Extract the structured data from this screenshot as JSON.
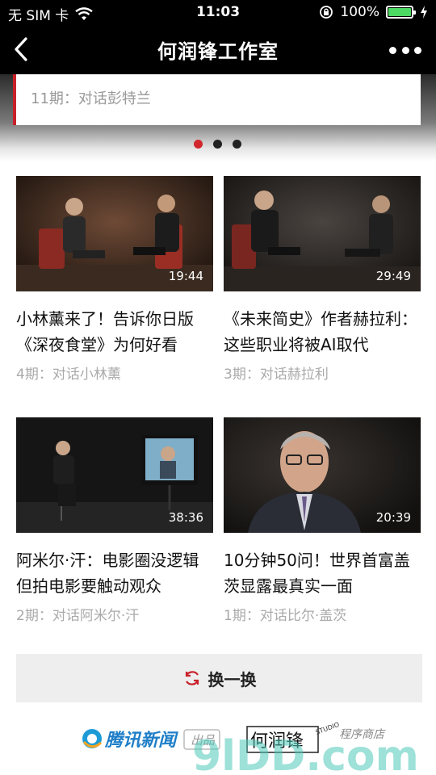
{
  "status_bar": {
    "carrier": "无 SIM 卡",
    "time": "11:03",
    "battery": "100%",
    "battery_level": 1.0
  },
  "nav": {
    "title": "何润锋工作室"
  },
  "banner": {
    "text": "11期：对话彭特兰",
    "pages": 3,
    "active_page": 1
  },
  "videos": [
    {
      "duration": "19:44",
      "title": "小林薰来了！告诉你日版《深夜食堂》为何好看",
      "episode": "4期：对话小林薰"
    },
    {
      "duration": "29:49",
      "title": "《未来简史》作者赫拉利：这些职业将被AI取代",
      "episode": "3期：对话赫拉利"
    },
    {
      "duration": "38:36",
      "title": "阿米尔·汗：电影圈没逻辑 但拍电影要触动观众",
      "episode": "2期：对话阿米尔·汗"
    },
    {
      "duration": "20:39",
      "title": "10分钟50问！世界首富盖茨显露最真实一面",
      "episode": "1期：对话比尔·盖茨"
    }
  ],
  "refresh_label": "换一换",
  "footer": {
    "brand": "腾讯新闻",
    "tag": "出品",
    "studio": "何润锋",
    "studio_en": "STUDIO",
    "watermark": "9lDD.com",
    "watermark_note": "程序商店"
  }
}
